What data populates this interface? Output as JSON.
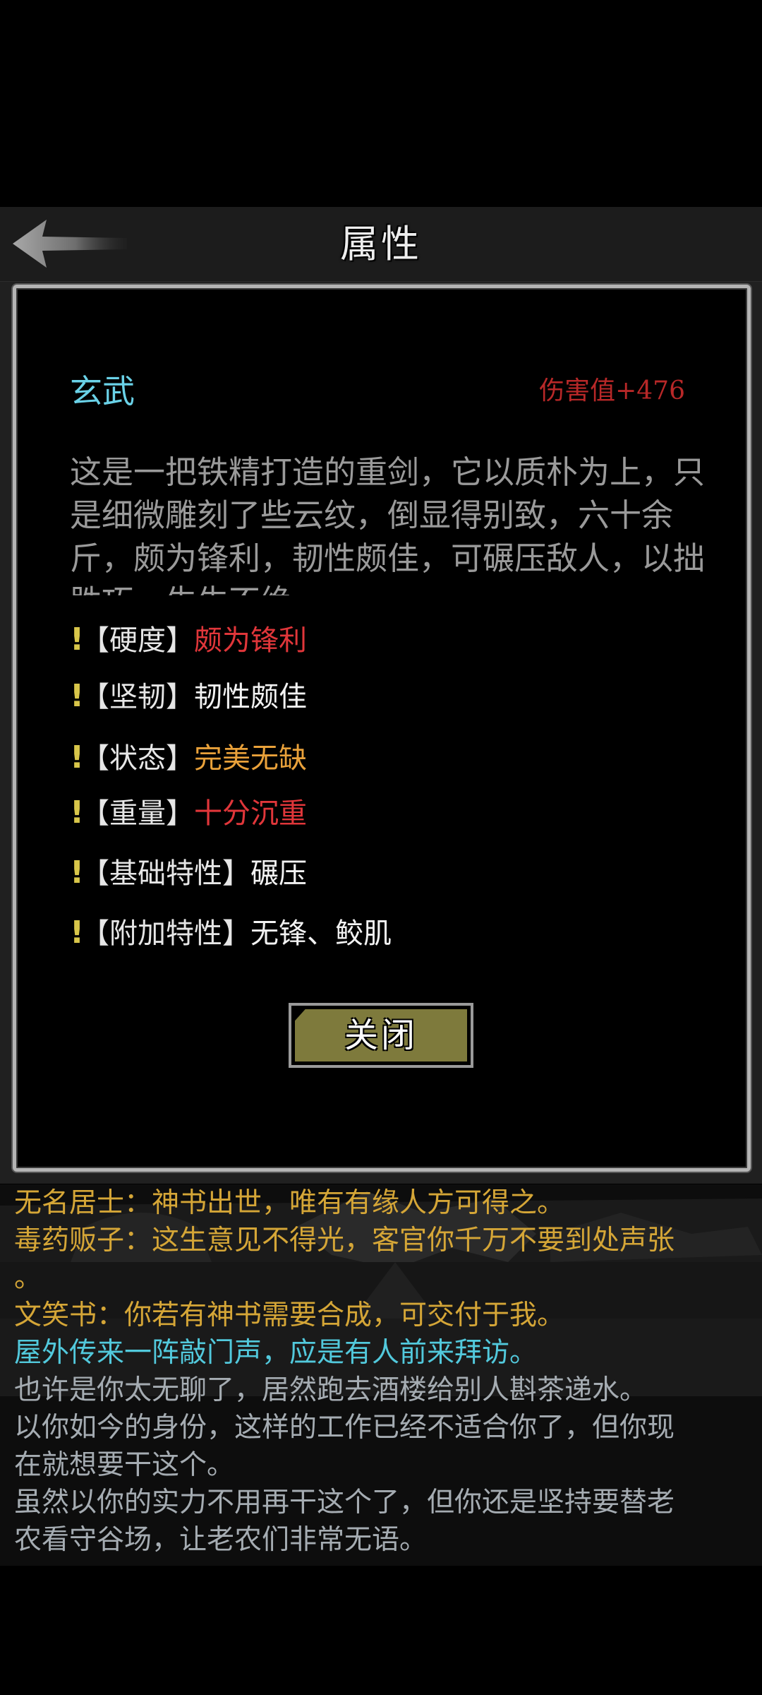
{
  "header": {
    "title": "属性",
    "back_icon": "back-arrow-icon"
  },
  "item": {
    "name": "玄武",
    "damage": "伤害值+476",
    "description": "这是一把铁精打造的重剑，它以质朴为上，只是细微雕刻了些云纹，倒显得别致，六十余斤，颇为锋利，韧性颇佳，可碾压敌人，以拙胜巧，生生不绝"
  },
  "attributes": [
    {
      "marker": "!",
      "label": "【硬度】",
      "value": "颇为锋利",
      "color": "#e0363a"
    },
    {
      "marker": "!",
      "label": "【坚韧】",
      "value": "韧性颇佳",
      "color": "#f2f2f2"
    },
    {
      "marker": "!",
      "label": "【状态】",
      "value": "完美无缺",
      "color": "#e9a13a"
    },
    {
      "marker": "!",
      "label": "【重量】",
      "value": "十分沉重",
      "color": "#e0363a"
    },
    {
      "marker": "!",
      "label": "【基础特性】",
      "value": "碾压",
      "color": "#f2f2f2"
    },
    {
      "marker": "!",
      "label": "【附加特性】",
      "value": "无锋、鲛肌",
      "color": "#f2f2f2"
    }
  ],
  "close_button": {
    "label": "关闭"
  },
  "log": [
    {
      "text": "无名居士：神书出世，唯有有缘人方可得之。",
      "color": "#d5a637"
    },
    {
      "text": "毒药贩子：这生意见不得光，客官你千万不要到处声张",
      "color": "#d5a637"
    },
    {
      "text": "。",
      "color": "#d5a637"
    },
    {
      "text": "文笑书：你若有神书需要合成，可交付于我。",
      "color": "#d5a637"
    },
    {
      "text": "屋外传来一阵敲门声，应是有人前来拜访。",
      "color": "#52c9dc"
    },
    {
      "text": "也许是你太无聊了，居然跑去酒楼给别人斟茶递水。",
      "color": "#a5acb2"
    },
    {
      "text": "以你如今的身份，这样的工作已经不适合你了，但你现",
      "color": "#a5acb2"
    },
    {
      "text": "在就想要干这个。",
      "color": "#a5acb2"
    },
    {
      "text": "虽然以你的实力不用再干这个了，但你还是坚持要替老",
      "color": "#a5acb2"
    },
    {
      "text": "农看守谷场，让老农们非常无语。",
      "color": "#a5acb2"
    }
  ]
}
